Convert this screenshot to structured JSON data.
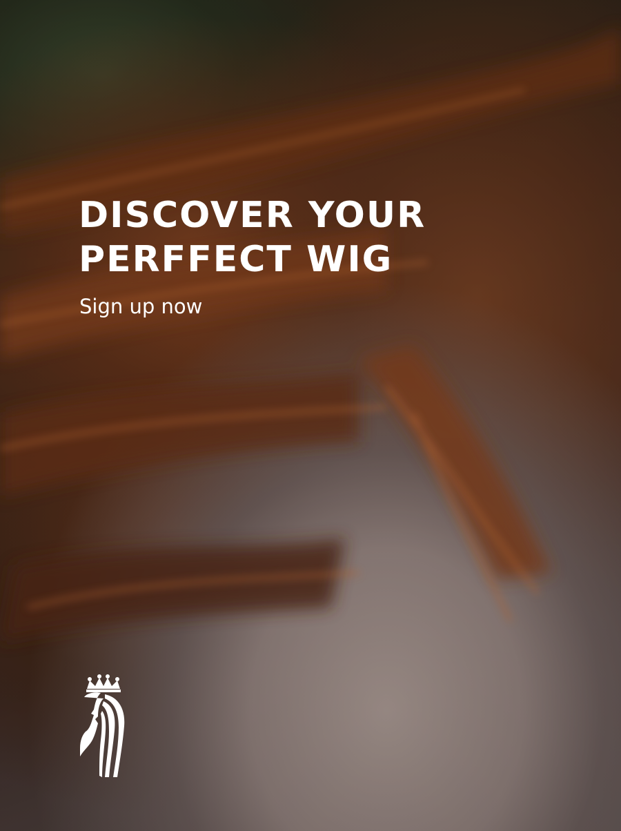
{
  "hero": {
    "headline_line1": "DISCOVER YOUR",
    "headline_line2": "PERFFECT WIG",
    "cta_label": "Sign up now"
  },
  "brand": {
    "logo_icon": "queen-silhouette-crown-logo"
  },
  "colors": {
    "text": "#ffffff",
    "hair": "#7a3d1c",
    "sweater": "#9a8b87"
  }
}
